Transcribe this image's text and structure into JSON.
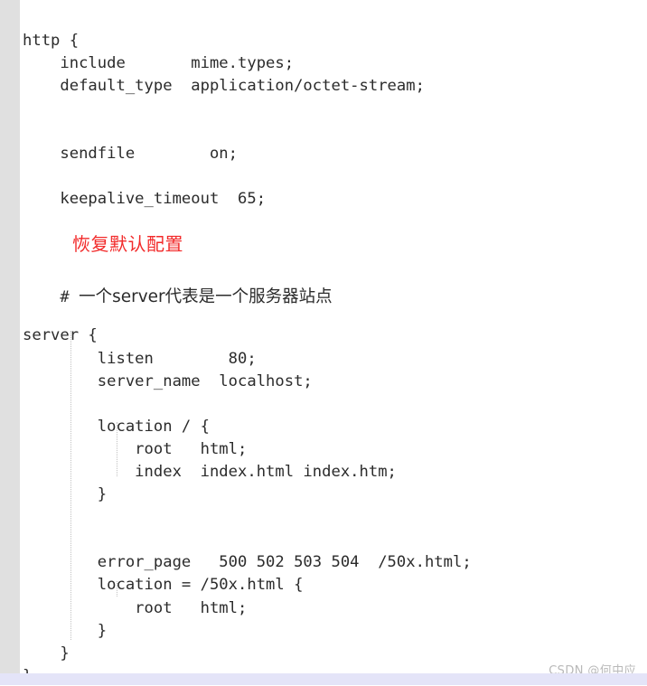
{
  "page": {
    "kind": "code-screenshot",
    "language": "nginx-conf",
    "background_color": "#ffffff",
    "gutter_color": "#e0e0e0",
    "footer_band_color": "#e4e4f8",
    "code_color": "#2b2b2b",
    "accent_red": "#f22a2a",
    "guide_color": "#c2c2c2",
    "watermark_color": "#b9b9b9"
  },
  "annotation": {
    "red_heading": "恢复默认配置"
  },
  "watermark": {
    "text": "CSDN @何中应"
  },
  "code": {
    "lines": [
      {
        "id": "l1",
        "text": "http {"
      },
      {
        "id": "l2",
        "text": "    include       mime.types;"
      },
      {
        "id": "l3",
        "text": "    default_type  application/octet-stream;"
      },
      {
        "id": "l4",
        "text": ""
      },
      {
        "id": "l5",
        "text": ""
      },
      {
        "id": "l6",
        "text": "    sendfile        on;"
      },
      {
        "id": "l7",
        "text": ""
      },
      {
        "id": "l8",
        "text": "    keepalive_timeout  65;"
      },
      {
        "id": "l9",
        "text": ""
      },
      {
        "id": "l10",
        "text": ""
      },
      {
        "id": "l11",
        "text": ""
      },
      {
        "id": "l12",
        "text": ""
      },
      {
        "id": "l13",
        "prefix": "    # ",
        "cjk_text": "一个server代表是一个服务器站点"
      },
      {
        "id": "l14",
        "text": "server {"
      },
      {
        "id": "l15",
        "text": "        listen        80;"
      },
      {
        "id": "l16",
        "text": "        server_name  localhost;"
      },
      {
        "id": "l17",
        "text": ""
      },
      {
        "id": "l18",
        "text": "        location / {"
      },
      {
        "id": "l19",
        "text": "            root   html;"
      },
      {
        "id": "l20",
        "text": "            index  index.html index.htm;"
      },
      {
        "id": "l21",
        "text": "        }"
      },
      {
        "id": "l22",
        "text": ""
      },
      {
        "id": "l23",
        "text": ""
      },
      {
        "id": "l24",
        "text": "        error_page   500 502 503 504  /50x.html;"
      },
      {
        "id": "l25",
        "text": "        location = /50x.html {"
      },
      {
        "id": "l26",
        "text": "            root   html;"
      },
      {
        "id": "l27",
        "text": "        }"
      },
      {
        "id": "l28",
        "text": "    }"
      },
      {
        "id": "l29",
        "text": "}"
      }
    ]
  }
}
